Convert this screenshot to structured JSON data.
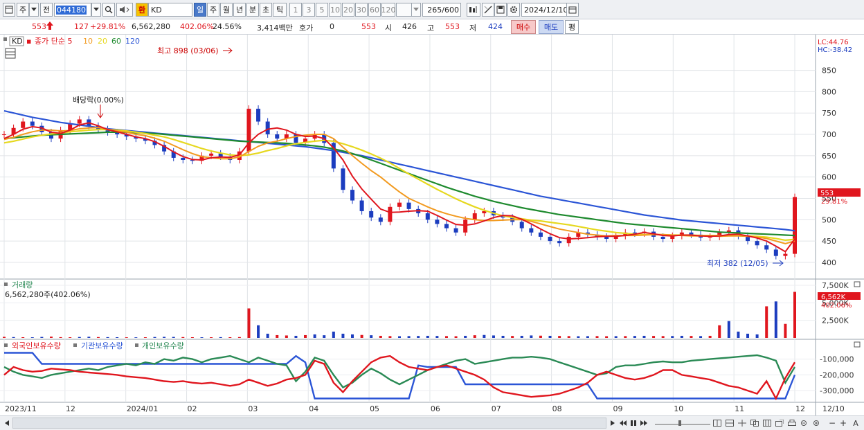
{
  "toolbar": {
    "period_label": "주",
    "prev_label": "전",
    "code": "044180",
    "exchange_label": "환",
    "name": "KD",
    "periods": [
      "일",
      "주",
      "월",
      "년",
      "분",
      "초",
      "틱"
    ],
    "active_period": "일",
    "intervals": [
      "1",
      "3",
      "5",
      "10",
      "20",
      "30",
      "60",
      "120"
    ],
    "count_value": "265",
    "count_total": "/600",
    "date": "2024/12/10"
  },
  "quote": {
    "price": "553",
    "change": "127",
    "change_pct": "+29.81%",
    "volume": "6,562,280",
    "volume_ratio": "402.06%",
    "turnover": "24.56%",
    "amount": "3,414백만",
    "bid_label": "호가",
    "bid_value": "0",
    "ask_value": "553",
    "open_label": "시",
    "open_value": "426",
    "high_label": "고",
    "high_value": "553",
    "low_label": "저",
    "low_value": "424",
    "buy_label": "매수",
    "sell_label": "매도",
    "eval_label": "평"
  },
  "chart_data": [
    {
      "type": "line",
      "title": "KD",
      "legend": [
        "종가 단순 5",
        "10",
        "20",
        "60",
        "120"
      ],
      "legend_colors": [
        "#e0161e",
        "#f29a1f",
        "#e6d81f",
        "#1e8a2e",
        "#2b55d6"
      ],
      "y_ticks": [
        "850",
        "800",
        "750",
        "700",
        "650",
        "600",
        "550",
        "500",
        "450",
        "400"
      ],
      "ylim": [
        382,
        898
      ],
      "top_label_lc": "LC:44.76",
      "top_label_hc": "HC:-38.42",
      "price_tag": "553",
      "price_pct_tag": "29.81%",
      "high_annotation": "최고 898 (03/06)",
      "low_annotation": "최저 382 (12/05)",
      "dividend_annotation": "배당락(0.00%)",
      "x_labels": [
        "2023/11",
        "12",
        "2024/01",
        "02",
        "03",
        "04",
        "05",
        "06",
        "07",
        "08",
        "09",
        "10",
        "11",
        "12",
        "12/10"
      ],
      "close": [
        700,
        715,
        730,
        720,
        705,
        690,
        710,
        725,
        735,
        720,
        712,
        705,
        700,
        695,
        690,
        685,
        675,
        660,
        645,
        640,
        638,
        650,
        655,
        648,
        640,
        660,
        760,
        730,
        700,
        690,
        700,
        680,
        690,
        700,
        680,
        620,
        570,
        545,
        520,
        505,
        495,
        530,
        540,
        525,
        515,
        500,
        490,
        480,
        470,
        500,
        515,
        520,
        510,
        505,
        495,
        480,
        470,
        460,
        450,
        445,
        460,
        470,
        465,
        460,
        455,
        462,
        470,
        468,
        472,
        460,
        455,
        462,
        470,
        465,
        458,
        460,
        470,
        475,
        462,
        450,
        440,
        430,
        415,
        420,
        553
      ],
      "ma5": [
        690,
        700,
        712,
        718,
        715,
        705,
        702,
        710,
        722,
        727,
        720,
        711,
        706,
        700,
        694,
        690,
        683,
        672,
        659,
        648,
        641,
        640,
        645,
        647,
        646,
        652,
        680,
        700,
        712,
        715,
        710,
        700,
        695,
        696,
        690,
        668,
        640,
        602,
        572,
        548,
        525,
        517,
        518,
        520,
        521,
        520,
        510,
        499,
        489,
        487,
        490,
        497,
        505,
        510,
        509,
        501,
        490,
        478,
        467,
        458,
        455,
        456,
        458,
        460,
        461,
        461,
        463,
        466,
        470,
        467,
        463,
        462,
        464,
        464,
        462,
        461,
        462,
        465,
        466,
        462,
        457,
        450,
        438,
        425,
        455
      ],
      "ma10": [
        688,
        693,
        700,
        706,
        710,
        710,
        708,
        709,
        713,
        715,
        716,
        712,
        708,
        705,
        700,
        697,
        691,
        684,
        674,
        664,
        655,
        648,
        645,
        643,
        643,
        647,
        660,
        672,
        680,
        684,
        690,
        695,
        698,
        700,
        700,
        690,
        670,
        650,
        632,
        615,
        600,
        582,
        565,
        550,
        540,
        530,
        521,
        514,
        508,
        503,
        500,
        498,
        498,
        499,
        500,
        500,
        496,
        490,
        484,
        478,
        474,
        470,
        466,
        464,
        462,
        463,
        463,
        463,
        464,
        465,
        465,
        464,
        463,
        462,
        462,
        462,
        461,
        462,
        462,
        461,
        459,
        456,
        450,
        444,
        450
      ],
      "ma20": [
        680,
        684,
        689,
        694,
        698,
        701,
        703,
        706,
        708,
        710,
        711,
        711,
        710,
        708,
        705,
        702,
        698,
        694,
        688,
        681,
        674,
        667,
        661,
        656,
        652,
        650,
        652,
        656,
        662,
        667,
        673,
        678,
        681,
        684,
        686,
        684,
        678,
        671,
        663,
        654,
        644,
        633,
        620,
        607,
        595,
        583,
        571,
        560,
        549,
        539,
        530,
        522,
        515,
        509,
        505,
        502,
        499,
        497,
        494,
        491,
        488,
        484,
        480,
        476,
        473,
        470,
        468,
        466,
        465,
        465,
        465,
        464,
        464,
        464,
        463,
        463,
        463,
        463,
        463,
        462,
        461,
        459,
        456,
        452,
        454
      ],
      "ma60": [
        690,
        692,
        694,
        696,
        698,
        699,
        700,
        701,
        702,
        703,
        704,
        705,
        705,
        705,
        704,
        703,
        702,
        700,
        698,
        696,
        694,
        692,
        690,
        688,
        686,
        684,
        683,
        682,
        681,
        680,
        679,
        677,
        675,
        673,
        670,
        666,
        661,
        655,
        648,
        640,
        632,
        624,
        616,
        608,
        600,
        592,
        584,
        576,
        569,
        562,
        555,
        549,
        543,
        538,
        533,
        528,
        524,
        520,
        516,
        512,
        509,
        506,
        503,
        500,
        497,
        494,
        491,
        489,
        487,
        485,
        483,
        481,
        479,
        477,
        475,
        473,
        471,
        470,
        469,
        468,
        467,
        466,
        465,
        464,
        463
      ],
      "ma120": [
        755,
        750,
        745,
        740,
        736,
        732,
        728,
        725,
        722,
        719,
        716,
        713,
        711,
        709,
        707,
        705,
        703,
        701,
        699,
        697,
        695,
        693,
        691,
        689,
        687,
        685,
        683,
        681,
        679,
        677,
        675,
        673,
        671,
        668,
        665,
        662,
        658,
        654,
        650,
        645,
        640,
        635,
        630,
        625,
        620,
        615,
        610,
        605,
        600,
        595,
        590,
        585,
        580,
        575,
        570,
        565,
        560,
        555,
        551,
        547,
        543,
        539,
        535,
        531,
        527,
        523,
        519,
        515,
        511,
        508,
        505,
        502,
        499,
        497,
        495,
        493,
        491,
        489,
        487,
        485,
        483,
        481,
        479,
        477,
        474
      ]
    },
    {
      "type": "bar",
      "title": "거래량",
      "subtitle": "6,562,280주(402.06%)",
      "y_ticks": [
        "7,500K",
        "5,000K",
        "2,500K"
      ],
      "ylim": [
        0,
        7500
      ],
      "value_tag": "6,562K",
      "pct_tag": "402.06%",
      "values": [
        150,
        120,
        100,
        90,
        140,
        180,
        110,
        95,
        130,
        160,
        120,
        110,
        100,
        90,
        85,
        95,
        130,
        150,
        140,
        120,
        100,
        90,
        95,
        110,
        100,
        120,
        4200,
        1800,
        600,
        400,
        350,
        300,
        400,
        500,
        380,
        900,
        600,
        500,
        420,
        380,
        300,
        260,
        240,
        260,
        280,
        300,
        280,
        260,
        240,
        300,
        380,
        420,
        350,
        300,
        280,
        300,
        350,
        320,
        300,
        280,
        260,
        240,
        250,
        260,
        240,
        250,
        260,
        280,
        300,
        280,
        260,
        270,
        300,
        280,
        260,
        300,
        1800,
        2400,
        900,
        600,
        500,
        4500,
        5200,
        2000,
        6562
      ],
      "up": [
        true,
        false,
        true,
        false,
        false,
        true,
        true,
        true,
        false,
        false,
        true,
        false,
        false,
        true,
        false,
        true,
        false,
        false,
        false,
        true,
        true,
        false,
        true,
        false,
        true,
        true,
        true,
        false,
        false,
        true,
        true,
        false,
        true,
        false,
        false,
        false,
        false,
        false,
        true,
        false,
        true,
        true,
        false,
        false,
        false,
        false,
        false,
        true,
        true,
        false,
        true,
        false,
        false,
        false,
        true,
        false,
        false,
        true,
        false,
        true,
        true,
        false,
        false,
        true,
        true,
        false,
        true,
        false,
        false,
        true,
        true,
        false,
        false,
        true,
        false,
        true,
        true,
        false,
        false,
        false,
        false,
        true,
        false,
        true,
        true
      ]
    },
    {
      "type": "line",
      "title": "외국인보유수량",
      "legend": [
        "외국인보유수량",
        "기관보유수량",
        "개인보유수량"
      ],
      "legend_colors": [
        "#e0161e",
        "#2b55d6",
        "#2a8a55"
      ],
      "y_ticks": [
        "-100,000",
        "-200,000",
        "-300,000"
      ],
      "ylim": [
        -370000,
        -40000
      ],
      "foreign": [
        -200000,
        -150000,
        -170000,
        -180000,
        -175000,
        -160000,
        -165000,
        -170000,
        -180000,
        -185000,
        -190000,
        -195000,
        -200000,
        -210000,
        -215000,
        -220000,
        -230000,
        -240000,
        -245000,
        -240000,
        -250000,
        -255000,
        -250000,
        -260000,
        -270000,
        -260000,
        -230000,
        -250000,
        -270000,
        -255000,
        -230000,
        -220000,
        -200000,
        -110000,
        -130000,
        -250000,
        -310000,
        -240000,
        -180000,
        -120000,
        -90000,
        -80000,
        -120000,
        -150000,
        -160000,
        -170000,
        -150000,
        -140000,
        -160000,
        -180000,
        -200000,
        -230000,
        -280000,
        -310000,
        -320000,
        -330000,
        -340000,
        -335000,
        -330000,
        -320000,
        -300000,
        -280000,
        -250000,
        -200000,
        -180000,
        -200000,
        -220000,
        -230000,
        -220000,
        -200000,
        -170000,
        -170000,
        -200000,
        -210000,
        -220000,
        -230000,
        -250000,
        -270000,
        -280000,
        -300000,
        -320000,
        -240000,
        -350000,
        -220000,
        -120000
      ],
      "institution": [
        -60000,
        -60000,
        -60000,
        -60000,
        -130000,
        -130000,
        -130000,
        -130000,
        -130000,
        -130000,
        -130000,
        -130000,
        -130000,
        -130000,
        -130000,
        -130000,
        -130000,
        -130000,
        -130000,
        -130000,
        -130000,
        -130000,
        -130000,
        -130000,
        -130000,
        -130000,
        -130000,
        -130000,
        -130000,
        -130000,
        -130000,
        -80000,
        -120000,
        -350000,
        -350000,
        -350000,
        -350000,
        -350000,
        -350000,
        -350000,
        -350000,
        -350000,
        -350000,
        -350000,
        -140000,
        -150000,
        -150000,
        -150000,
        -150000,
        -260000,
        -260000,
        -260000,
        -260000,
        -260000,
        -260000,
        -260000,
        -260000,
        -260000,
        -260000,
        -260000,
        -260000,
        -260000,
        -260000,
        -350000,
        -350000,
        -350000,
        -350000,
        -350000,
        -350000,
        -350000,
        -350000,
        -350000,
        -350000,
        -350000,
        -350000,
        -350000,
        -350000,
        -350000,
        -350000,
        -350000,
        -350000,
        -350000,
        -350000,
        -350000,
        -200000
      ],
      "individual": [
        -150000,
        -180000,
        -200000,
        -210000,
        -220000,
        -200000,
        -190000,
        -180000,
        -170000,
        -160000,
        -170000,
        -150000,
        -140000,
        -130000,
        -140000,
        -120000,
        -130000,
        -100000,
        -110000,
        -90000,
        -100000,
        -120000,
        -100000,
        -90000,
        -80000,
        -100000,
        -120000,
        -90000,
        -110000,
        -130000,
        -140000,
        -240000,
        -180000,
        -90000,
        -110000,
        -200000,
        -280000,
        -250000,
        -200000,
        -160000,
        -190000,
        -230000,
        -260000,
        -230000,
        -200000,
        -170000,
        -150000,
        -130000,
        -110000,
        -100000,
        -130000,
        -120000,
        -110000,
        -100000,
        -90000,
        -90000,
        -85000,
        -90000,
        -100000,
        -120000,
        -140000,
        -160000,
        -180000,
        -200000,
        -190000,
        -150000,
        -140000,
        -140000,
        -130000,
        -120000,
        -115000,
        -120000,
        -120000,
        -110000,
        -105000,
        -100000,
        -95000,
        -90000,
        -85000,
        -80000,
        -75000,
        -90000,
        -110000,
        -250000,
        -150000
      ]
    }
  ],
  "status": {
    "zoom_minus": "−",
    "zoom_plus": "+",
    "auto": "A"
  }
}
